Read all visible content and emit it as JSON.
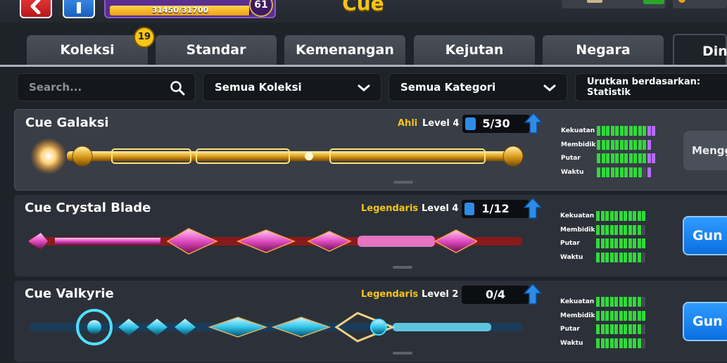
{
  "header": {
    "xp_text": "31450/31700",
    "xp_progress": 0.992,
    "player_level": "61",
    "title": "Cue",
    "notification_count": "19"
  },
  "tabs": [
    {
      "label": "Koleksi"
    },
    {
      "label": "Standar"
    },
    {
      "label": "Kemenangan"
    },
    {
      "label": "Kejutan"
    },
    {
      "label": "Negara"
    },
    {
      "label": "Din"
    }
  ],
  "filters": {
    "search_placeholder": "Search...",
    "collection": "Semua Koleksi",
    "category": "Semua Kategori",
    "sort": "Urutkan berdasarkan: Statistik"
  },
  "cues": [
    {
      "name": "Cue Galaksi",
      "rarity": "Ahli",
      "level": "Level 4",
      "progress_text": "5/30",
      "progress": 0.1667,
      "stats": [
        {
          "label": "Kekuatan",
          "green": 11,
          "purple": 2
        },
        {
          "label": "Membidik",
          "green": 11,
          "purple": 1
        },
        {
          "label": "Putar",
          "green": 11,
          "purple": 2
        },
        {
          "label": "Waktu",
          "green": 10,
          "purple": 1
        }
      ],
      "action": "Mengg"
    },
    {
      "name": "Cue Crystal Blade",
      "rarity": "Legendaris",
      "level": "Level 4",
      "progress_text": "1/12",
      "progress": 0.0833,
      "stats": [
        {
          "label": "Kekuatan",
          "green": 11,
          "purple": 0
        },
        {
          "label": "Membidik",
          "green": 10,
          "purple": 0
        },
        {
          "label": "Putar",
          "green": 11,
          "purple": 0
        },
        {
          "label": "Waktu",
          "green": 10,
          "purple": 0
        }
      ],
      "action": "Gun"
    },
    {
      "name": "Cue Valkyrie",
      "rarity": "Legendaris",
      "level": "Level 2",
      "progress_text": "0/4",
      "progress": 0,
      "stats": [
        {
          "label": "Kekuatan",
          "green": 10,
          "purple": 0
        },
        {
          "label": "Membidik",
          "green": 11,
          "purple": 0
        },
        {
          "label": "Putar",
          "green": 10,
          "purple": 0
        },
        {
          "label": "Waktu",
          "green": 10,
          "purple": 0
        }
      ],
      "action": "Gun"
    }
  ],
  "colors": {
    "accent_gold": "#f5c518",
    "stat_green": "#31d93b",
    "stat_purple": "#b56cff",
    "button_blue": "#0b6fe0"
  }
}
